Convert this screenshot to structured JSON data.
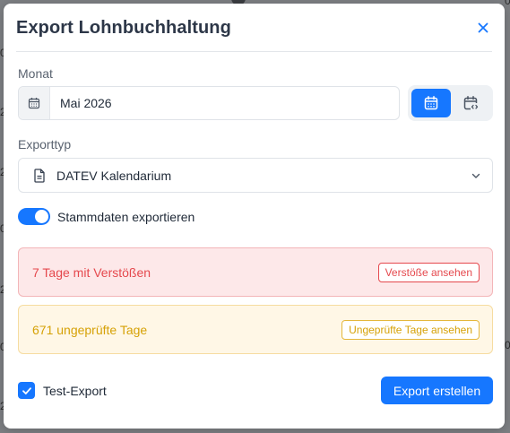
{
  "background": {
    "left_fragments": [
      "0",
      "2",
      "2",
      "0",
      "2",
      "0",
      "2",
      "0"
    ],
    "right_fragments": [
      "0",
      "0"
    ]
  },
  "dialog": {
    "title": "Export Lohnbuchhaltung",
    "close_icon": "close-icon"
  },
  "month": {
    "label": "Monat",
    "value": "Mai 2026",
    "prefix_icon": "calendar-icon",
    "mode_buttons": [
      {
        "icon": "calendar-month-icon",
        "active": true
      },
      {
        "icon": "calendar-range-icon",
        "active": false
      }
    ]
  },
  "export_type": {
    "label": "Exporttyp",
    "value": "DATEV Kalendarium",
    "icon": "document-icon",
    "chevron_icon": "chevron-down-icon"
  },
  "master_data_toggle": {
    "label": "Stammdaten exportieren",
    "on": true
  },
  "alerts": {
    "violations": {
      "text": "7 Tage mit Verstößen",
      "button": "Verstöße ansehen"
    },
    "unchecked": {
      "text": "671 ungeprüfte Tage",
      "button": "Ungeprüfte Tage ansehen"
    }
  },
  "test_export": {
    "label": "Test-Export",
    "checked": true
  },
  "submit_button": "Export erstellen",
  "colors": {
    "primary": "#1677ff",
    "danger": "#e5484d",
    "warning": "#d6a106",
    "title": "#2d3748"
  }
}
